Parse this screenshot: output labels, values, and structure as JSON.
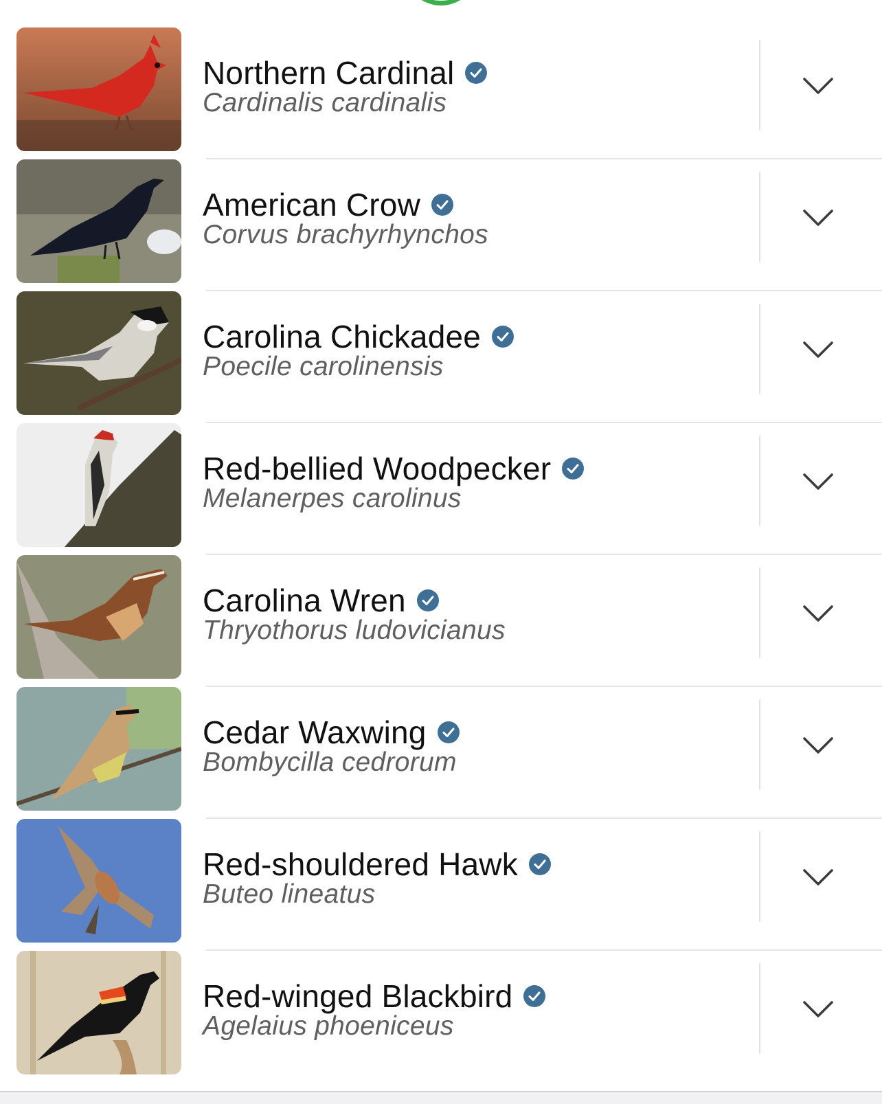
{
  "colors": {
    "accent_green": "#3dae4b",
    "verified_badge": "#3f6f95",
    "scientific_name_text": "#5f5f5f"
  },
  "species": [
    {
      "common_name": "Northern Cardinal",
      "scientific_name": "Cardinalis cardinalis",
      "verified": true,
      "thumbnail": "cardinal-photo"
    },
    {
      "common_name": "American Crow",
      "scientific_name": "Corvus brachyrhynchos",
      "verified": true,
      "thumbnail": "crow-photo"
    },
    {
      "common_name": "Carolina Chickadee",
      "scientific_name": "Poecile carolinensis",
      "verified": true,
      "thumbnail": "chickadee-photo"
    },
    {
      "common_name": "Red-bellied Woodpecker",
      "scientific_name": "Melanerpes carolinus",
      "verified": true,
      "thumbnail": "woodpecker-photo"
    },
    {
      "common_name": "Carolina Wren",
      "scientific_name": "Thryothorus ludovicianus",
      "verified": true,
      "thumbnail": "wren-photo"
    },
    {
      "common_name": "Cedar Waxwing",
      "scientific_name": "Bombycilla cedrorum",
      "verified": true,
      "thumbnail": "waxwing-photo"
    },
    {
      "common_name": "Red-shouldered Hawk",
      "scientific_name": "Buteo lineatus",
      "verified": true,
      "thumbnail": "hawk-photo"
    },
    {
      "common_name": "Red-winged Blackbird",
      "scientific_name": "Agelaius phoeniceus",
      "verified": true,
      "thumbnail": "blackbird-photo"
    }
  ]
}
